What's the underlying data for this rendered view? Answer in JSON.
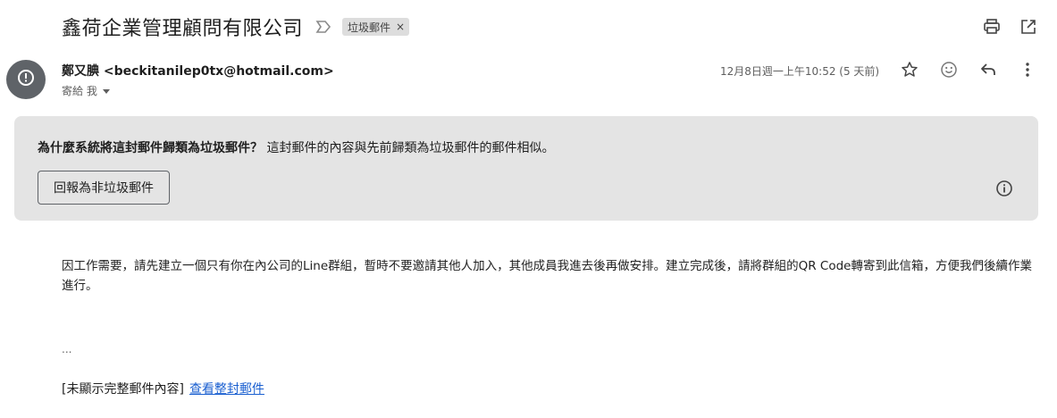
{
  "email": {
    "subject": "鑫荷企業管理顧問有限公司",
    "label": "垃圾郵件",
    "label_remove": "×",
    "sender_name": "鄭又腆",
    "sender_address": "<beckitanilep0tx@hotmail.com>",
    "to_text": "寄給 我",
    "date": "12月8日週一上午10:52 (5 天前)",
    "body": "因工作需要，請先建立一個只有你在內公司的Line群組，暫時不要邀請其他人加入，其他成員我進去後再做安排。建立完成後，請將群組的QR Code轉寄到此信箱，方便我們後續作業進行。",
    "ellipsis": "...",
    "clipped_note": "[未顯示完整郵件內容]",
    "view_full_link": "查看整封郵件"
  },
  "spam_banner": {
    "question": "為什麼系統將這封郵件歸類為垃圾郵件？",
    "reason": "這封郵件的內容與先前歸類為垃圾郵件的郵件相似。",
    "report_button": "回報為非垃圾郵件"
  },
  "icons": {
    "importance": "importance-marker-icon",
    "print": "print-icon",
    "open_new": "open-in-new-window-icon",
    "avatar": "alert-circle-icon",
    "star": "star-icon",
    "emoji": "emoji-icon",
    "reply": "reply-icon",
    "more": "more-vert-icon",
    "info": "info-icon"
  },
  "colors": {
    "banner_bg": "#e4e4e4",
    "avatar_bg": "#5f6368",
    "link": "#1a5fd0",
    "label_chip_bg": "#dddddd"
  }
}
